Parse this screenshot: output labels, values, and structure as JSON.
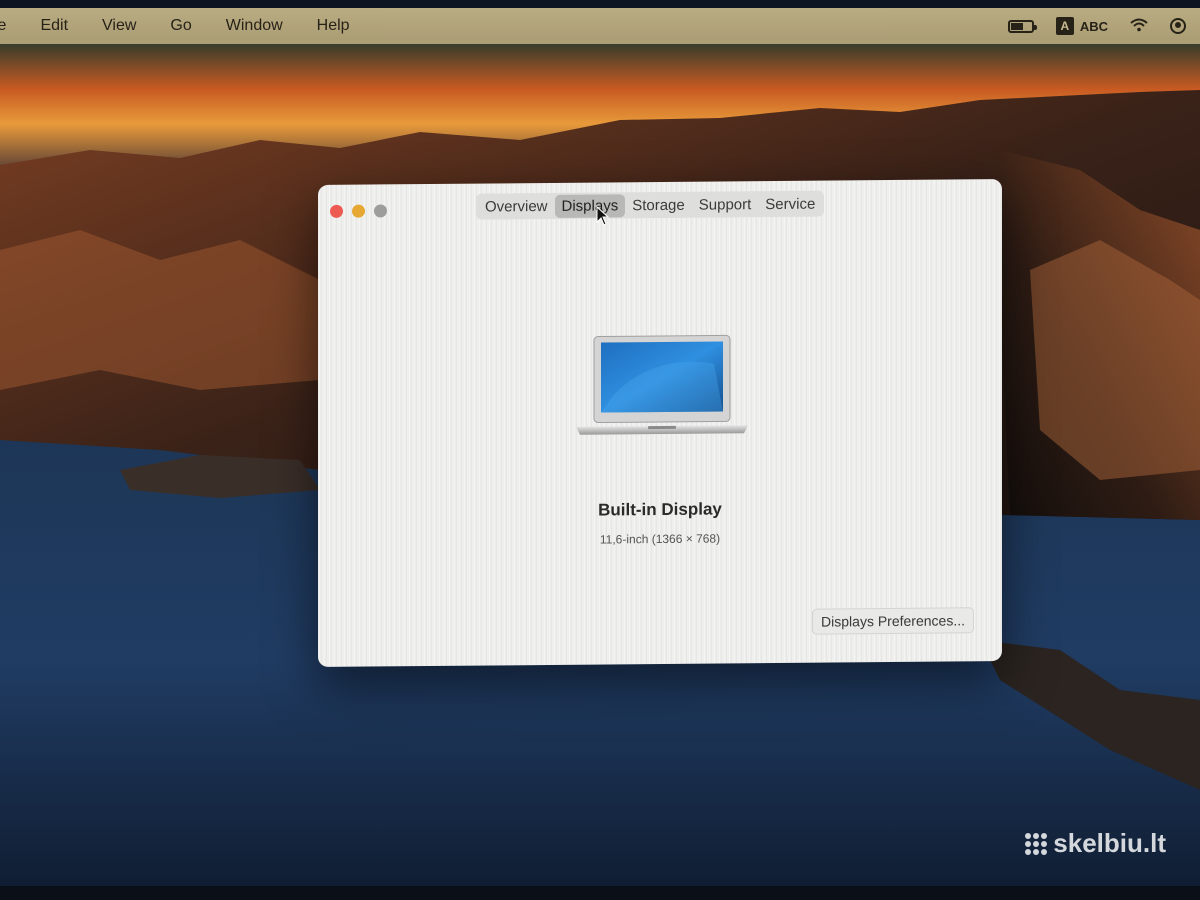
{
  "menubar": {
    "items": [
      "le",
      "Edit",
      "View",
      "Go",
      "Window",
      "Help"
    ],
    "input_source_badge": "A",
    "input_source": "ABC",
    "icons": [
      "battery-icon",
      "input-source-icon",
      "wifi-icon",
      "user-icon"
    ]
  },
  "dialog": {
    "tabs": [
      "Overview",
      "Displays",
      "Storage",
      "Support",
      "Service"
    ],
    "active_tab": "Displays",
    "display_name": "Built-in Display",
    "display_resolution": "11,6-inch (1366 × 768)",
    "prefs_button": "Displays Preferences..."
  },
  "watermark": {
    "text": "skelbiu.lt"
  },
  "colors": {
    "close": "#ed5a52",
    "minimize": "#e6a832",
    "zoom": "#9d9d9b",
    "menubar": "#c9b98a"
  }
}
